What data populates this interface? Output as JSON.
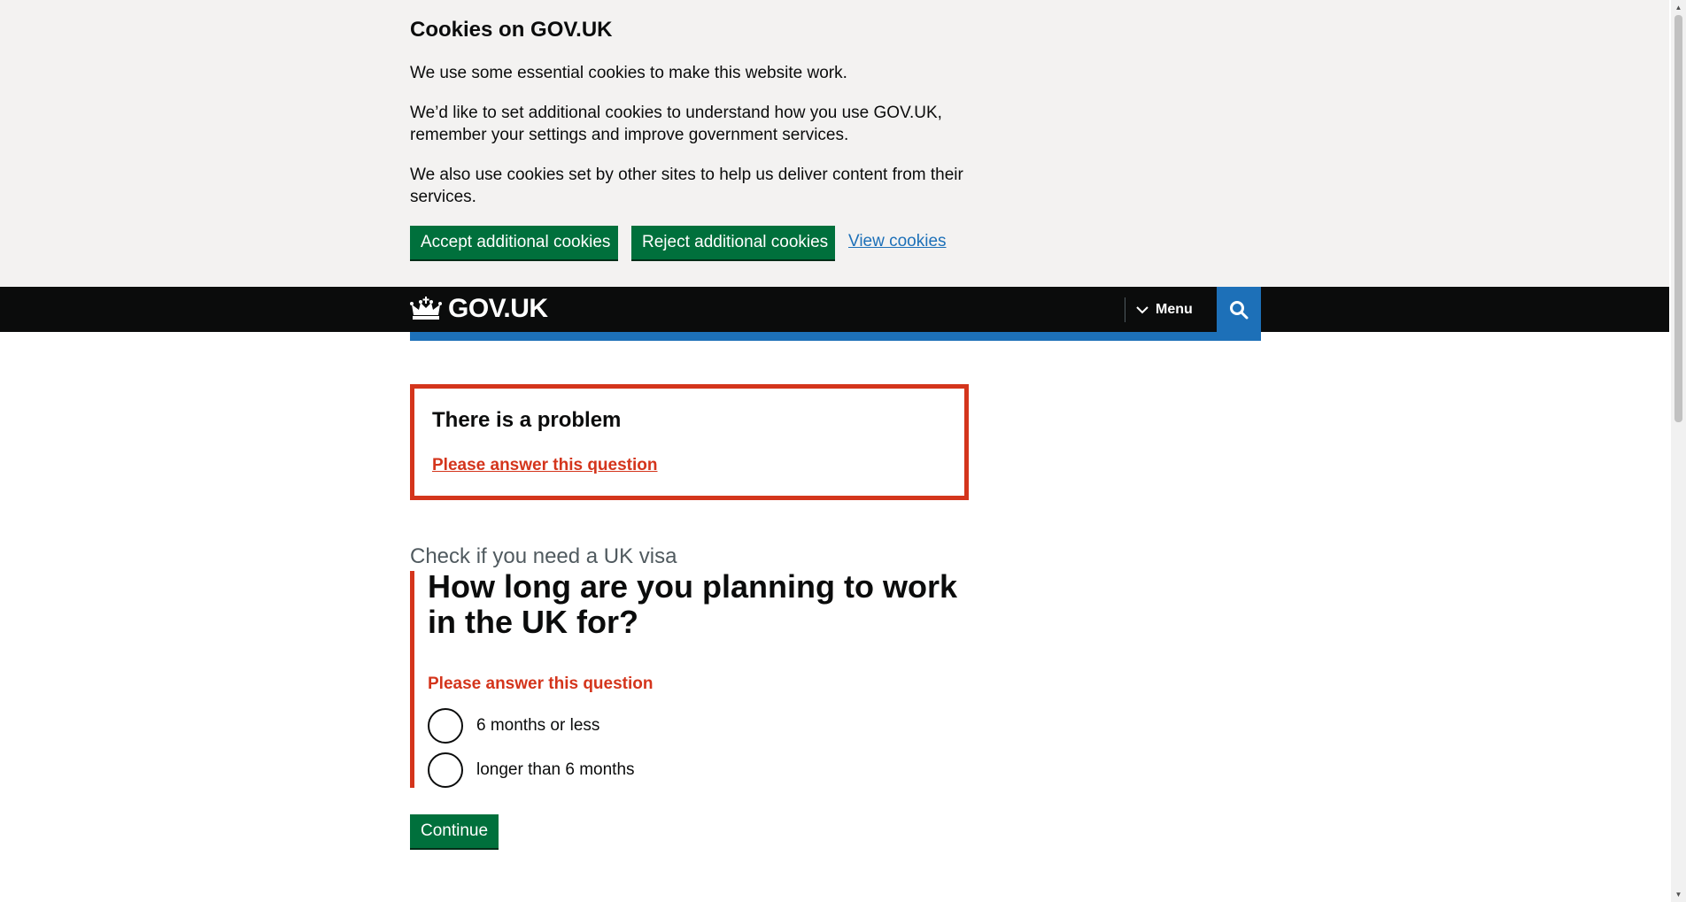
{
  "cookie_banner": {
    "title": "Cookies on GOV.UK",
    "paragraphs": [
      "We use some essential cookies to make this website work.",
      "We’d like to set additional cookies to understand how you use GOV.UK, remember your settings and improve government services.",
      "We also use cookies set by other sites to help us deliver content from their services."
    ],
    "accept_label": "Accept additional cookies",
    "reject_label": "Reject additional cookies",
    "view_label": "View cookies"
  },
  "header": {
    "logo_text": "GOV.UK",
    "menu_label": "Menu",
    "logo_icon": "crown-icon",
    "menu_icon": "chevron-down-icon",
    "search_icon": "search-icon"
  },
  "error_summary": {
    "title": "There is a problem",
    "link": "Please answer this question"
  },
  "question": {
    "caption": "Check if you need a UK visa",
    "heading": "How long are you planning to work in the UK for?",
    "error_message": "Please answer this question",
    "options": [
      "6 months or less",
      "longer than 6 months"
    ]
  },
  "continue_label": "Continue",
  "colors": {
    "brand_green": "#00703c",
    "error_red": "#d4351c",
    "link_blue": "#1d70b8",
    "header_black": "#0b0c0c"
  }
}
